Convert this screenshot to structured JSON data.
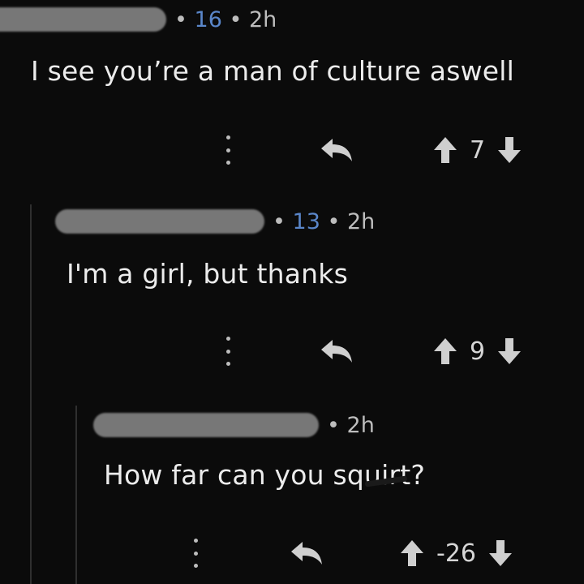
{
  "comments": [
    {
      "score": "16",
      "separator": "•",
      "time": "2h",
      "text": "I see you’re a man of culture aswell",
      "votes": "7"
    },
    {
      "score": "13",
      "separator": "•",
      "time": "2h",
      "text": "I'm a girl, but thanks",
      "votes": "9"
    },
    {
      "score": "",
      "separator": "•",
      "time": "2h",
      "text": "How far can you squirt?",
      "votes": "-26"
    }
  ],
  "icons": {
    "more": "kebab-icon",
    "reply": "reply-arrow-icon",
    "upvote": "upvote-arrow-icon",
    "downvote": "downvote-arrow-icon"
  },
  "colors": {
    "background": "#0b0b0b",
    "score": "#5a86c9",
    "text": "#ececec",
    "muted": "#bdbdbd"
  }
}
